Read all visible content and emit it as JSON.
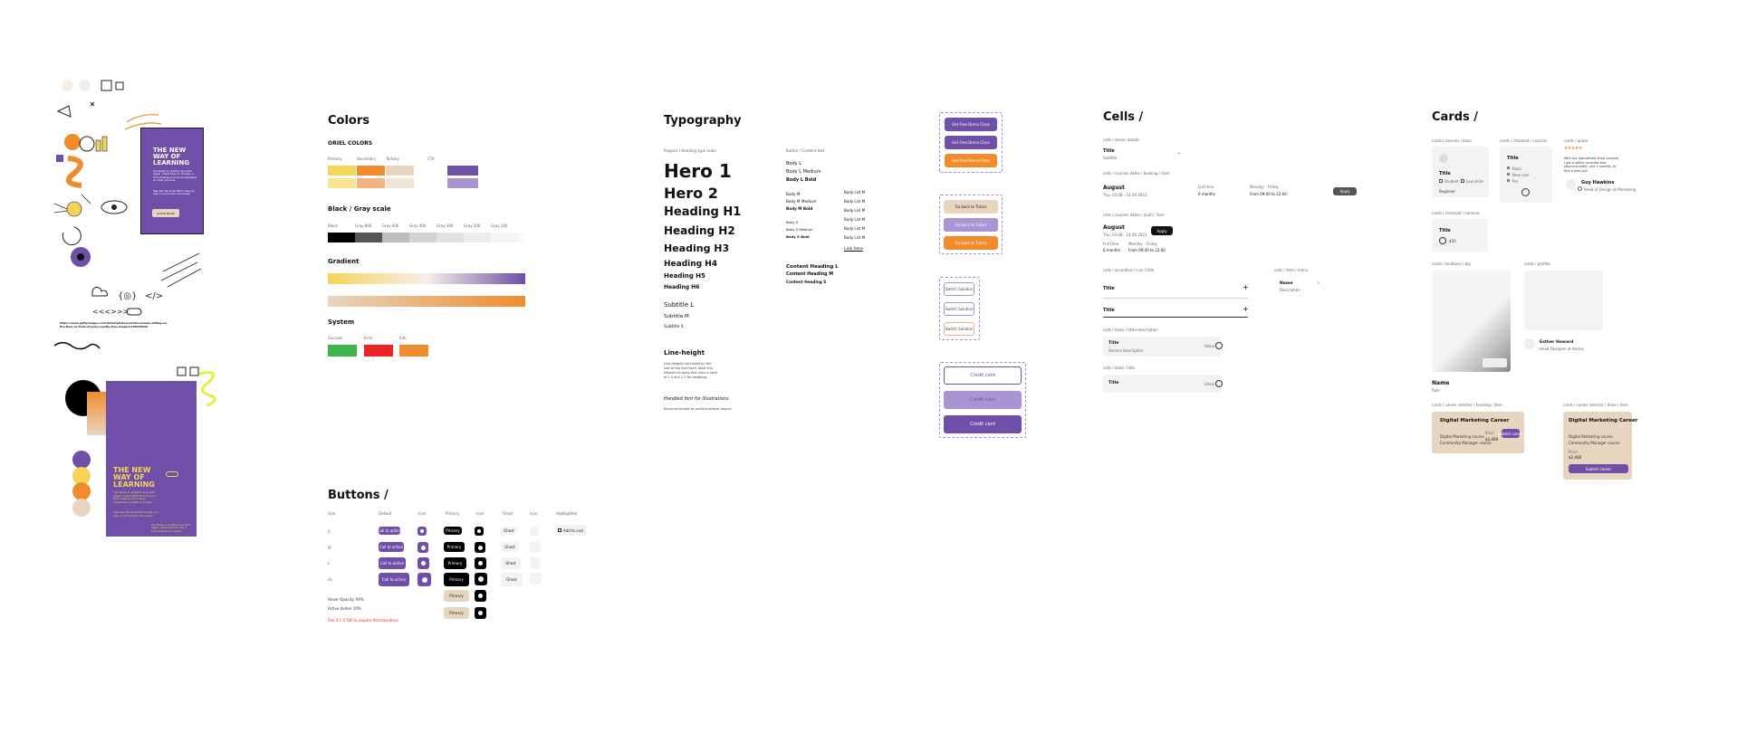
{
  "colors_section": {
    "title": "Colors",
    "oriel_label": "ORIEL COLORS",
    "oriel_swatch_labels": [
      "Primary",
      "Secondary",
      "Tertiary",
      "CTA"
    ],
    "gray_title": "Black / Gray scale",
    "gray_labels": [
      "Black",
      "Gray 800",
      "Gray 600",
      "Gray 400",
      "Gray 300",
      "Gray 200",
      "Gray 100",
      ""
    ],
    "gradient_title": "Gradient",
    "system_title": "System",
    "system_labels": [
      "Success",
      "Error",
      "Info"
    ],
    "palette": {
      "purple": "#6f4fa8",
      "orange": "#f08c2e",
      "yellow": "#f4d55a",
      "beige": "#e7d5bf",
      "green": "#3fb44c",
      "red": "#ee2424"
    }
  },
  "typography_section": {
    "title": "Typography",
    "font_note": "Poppins / Heading type scale",
    "body_note": "Button / Content text",
    "scale": [
      "Hero 1",
      "Hero 2",
      "Heading H1",
      "Heading H2",
      "Heading H3",
      "Heading H4",
      "Heading H5",
      "Heading H6"
    ],
    "subtitles": [
      "Subtitle L",
      "Subtitle M",
      "Subtitle S"
    ],
    "body_items": [
      "Body L",
      "Body L Medium",
      "Body L Bold",
      "Body M",
      "Body M Medium",
      "Body M Bold",
      "Body S",
      "Body S Medium",
      "Body S Bold"
    ],
    "list_items": [
      "Body List M",
      "Body List M",
      "Body List M",
      "Body List M",
      "Body List M",
      "Body List M"
    ],
    "link_label": "Link here",
    "content_headings": [
      "Content Heading L",
      "Content Heading M",
      "Content Heading S"
    ],
    "line_height_title": "Line-height",
    "line_height_text": "Line-heights are based on the size of the font itself. Ideal line-heights for body text have a ratio of 1.5 and 1.2 for headings.",
    "illustration_title": "Handled font for illustrations",
    "illustration_text": "Recommended to outline before export"
  },
  "cta_samples": {
    "demo_label": "Get Free Demo Class",
    "tutors_label": "Go back to Tutors",
    "small_label": "Switch Solution",
    "credit_label": "Credit card"
  },
  "buttons_section": {
    "title": "Buttons /",
    "columns": [
      "Size",
      "Default",
      "Icon",
      "Primary",
      "Icon",
      "Ghost",
      "Icon",
      "Highlighted"
    ],
    "sizes": [
      "S",
      "M",
      "L",
      "XL"
    ],
    "call_labels": [
      "Call to action",
      "Call to action",
      "Call to action",
      "Call to action"
    ],
    "primary_label": "Primary",
    "ghost_label": "Ghost",
    "add_label": "Add to cart",
    "notes": [
      "Hover Opacity: 90%",
      "Active darker 10%",
      "Use 3:1 0.5W to acquire the transitions"
    ]
  },
  "cells_section": {
    "title": "Cells /",
    "row_labels": [
      "cells / lesson details",
      "cells / courses dates / booking / item",
      "cells / courses dates / multi / item",
      "cells / accordion / icon / title",
      "cells / tasks / title+description",
      "cells / tasks / title"
    ],
    "title_word": "Title",
    "sub_word": "Subtitle",
    "date_word": "August",
    "date_detail": "Thu, 03.08 - 14.09 2023",
    "full_time": "Full time",
    "months": "6 months",
    "mon_fri": "Monday - Friday",
    "from_to": "From 09:00 to 22:00",
    "apply_label": "Apply",
    "service_label": "Service description",
    "value_label": "Value",
    "chips_label": "cells / item / menu",
    "name_label": "Name",
    "sub_name": "Description"
  },
  "cards_section": {
    "title": "Cards /",
    "labels": [
      "cards / courses / basic",
      "cards / checkout / courses",
      "cards / quote",
      "cards / checkout / services",
      "cards / locations / big",
      "cards / profiles",
      "cards / career selector / heading / item",
      "cards / career selector / done / item"
    ],
    "card_title": "Title",
    "options": [
      "Student",
      "Low skills",
      "Beginner"
    ],
    "radio_options": [
      "Basic",
      "New user",
      "Pro"
    ],
    "quote_text": "With our specialised short courses, I got a salary increase and advance within just 3 months, to find a new job!",
    "quote_name": "Guy Hawkins",
    "quote_role": "Head of Design at Marketing",
    "profile_name": "Esther Howard",
    "profile_role": "Head Designer at Kortos",
    "big_name": "Name",
    "big_role": "Role",
    "career_title": "Digital Marketing Career",
    "career_lines": [
      "Digital Marketing course",
      "Community Manager course"
    ],
    "career_price": "$2,408",
    "career_button": "Submit career",
    "price_label": "Price"
  },
  "left_mockups": {
    "url_text": "https://www.gettyimages.com/detail/photo/portrait-woman-sitting-on-the-floor-in-front-of-gray-royalty-free-image/1145050046",
    "poster_title": "THE NEW WAY OF LEARNING",
    "poster_body": "The design is carefully done with bigger, scaled fonts for the sign in. From existing accounts to emphasize on softer and eyes.",
    "poster_body2": "Help also fall at the MIT to help you stay in and receive such issues.",
    "poster_button": "SHOW MORE",
    "poster_footer": "The design is carefully done with bigger, scaled fonts for sign in from existing accounts to"
  }
}
